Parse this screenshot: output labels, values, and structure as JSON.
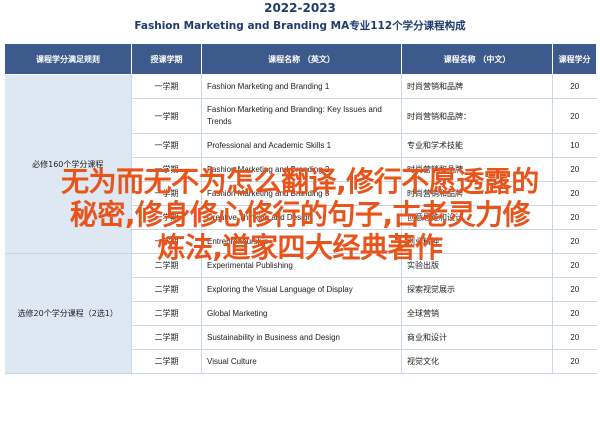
{
  "header": {
    "year": "2022-2023",
    "title": "Fashion Marketing and Branding MA专业112个学分课程构成"
  },
  "table": {
    "columns": [
      "课程学分满足规则",
      "授课学期",
      "课程名称 （英文）",
      "课程名称 （中文）",
      "课程学分"
    ],
    "categories": [
      "必修160个学分课程",
      "选修20个学分课程（2选1）"
    ],
    "rows": [
      {
        "semester": "一学期",
        "en": "Fashion Marketing and Branding 1",
        "zh": "时尚营销和品牌",
        "credits": "20"
      },
      {
        "semester": "一学期",
        "en": "Fashion Marketing and Branding: Key Issues and Trends",
        "zh": "时尚营销和品牌：",
        "credits": "20"
      },
      {
        "semester": "一学期",
        "en": "Professional and Academic Skills 1",
        "zh": "专业和学术技能",
        "credits": "10"
      },
      {
        "semester": "一学期",
        "en": "Fashion Marketing and Branding 2",
        "zh": "时尚营销和品牌",
        "credits": "20"
      },
      {
        "semester": "一学期",
        "en": "Fashion Marketing and Branding 3",
        "zh": "时尚营销和品牌",
        "credits": "20"
      },
      {
        "semester": "一学期",
        "en": "Creative Thinking and Design",
        "zh": "创意思维和设计",
        "credits": "20"
      },
      {
        "semester": "一学期",
        "en": "Entrepreneurship",
        "zh": "创业精神",
        "credits": "20"
      },
      {
        "semester": "二学期",
        "en": "Experimental Publishing",
        "zh": "实验出版",
        "credits": "20"
      },
      {
        "semester": "二学期",
        "en": "Exploring the Visual Language of Display",
        "zh": "探索视觉展示",
        "credits": "20"
      },
      {
        "semester": "二学期",
        "en": "Global Marketing",
        "zh": "全球营销",
        "credits": "20"
      },
      {
        "semester": "二学期",
        "en": "Sustainability in Business and Design",
        "zh": "商业和设计",
        "credits": "20"
      },
      {
        "semester": "二学期",
        "en": "Visual Culture",
        "zh": "视觉文化",
        "credits": "20"
      }
    ]
  },
  "overlay": {
    "line1": "无为而无不为怎么翻译,修行不愿透露的",
    "line2": "秘密,修身修心修行的句子,古老灵力修",
    "line3": "炼法,道家四大经典著作"
  }
}
